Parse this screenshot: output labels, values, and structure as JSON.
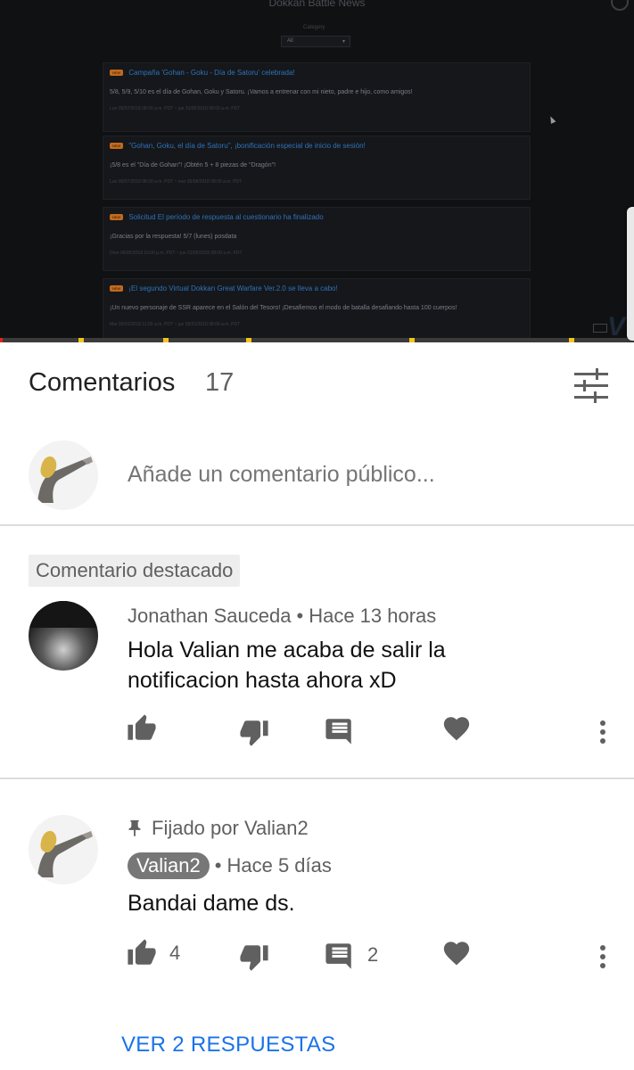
{
  "video": {
    "page_title": "Dokkan Battle News",
    "category_label": "Category",
    "category_value": "All",
    "news": [
      {
        "badge": "NEW",
        "title": "Campaña 'Gohan - Goku - Día de Satoru' celebrada!",
        "body": "5/8, 5/9, 5/10 es el día de Gohan, Goku y Satoru. ¡Vamos a entrenar con mi nieto, padre e hijo, como amigos!",
        "date": "Lun 05/07/2018 08:00 a.m. PDT ~ jue 31/05/2018 08:00 a.m. PDT"
      },
      {
        "badge": "NEW",
        "title": "\"Gohan, Goku, el día de Satoru\", ¡bonificación especial de inicio de sesión!",
        "body": "¡5/8 es el \"Día de Gohan\"! ¡Obtén 5 + 8 piezas de \"Dragón\"!",
        "date": "Lun 05/07/2018 08:00 a.m. PDT ~ mar 05/08/2018 08:00 a.m. PDT"
      },
      {
        "badge": "NEW",
        "title": "Solicitud El período de respuesta al cuestionario ha finalizado",
        "body": "¡Gracias por la respuesta! 5/7 (lunes) posdata",
        "date": "Dom 06/05/2018 10:00 p.m. PDT ~ jue 31/05/2018 08:00 a.m. PDT"
      },
      {
        "badge": "NEW",
        "title": "¡El segundo Virtual Dokkan Great Warfare Ver.2.0 se lleva a cabo!",
        "body": "¡Un nuevo personaje de SSR aparece en el Salón del Tesoro! ¡Desafiemos el modo de batalla desafiando hasta 100 cuerpos!",
        "date": "Mar 05/01/2018 11:00 a.m. PDT ~ jue 05/31/2018 08:00 a.m. PDT"
      }
    ],
    "progress": 0.004,
    "watermark": "V"
  },
  "comments_header": {
    "title": "Comentarios",
    "count": "17",
    "sort_icon": "sort-filter-icon"
  },
  "add_comment": {
    "placeholder": "Añade un comentario público..."
  },
  "comments": [
    {
      "featured_label": "Comentario destacado",
      "author": "Jonathan Sauceda",
      "separator": "•",
      "time": "Hace 13 horas",
      "text": "Hola Valian me acaba de salir la notificacion hasta ahora xD",
      "likes": "",
      "replies": ""
    },
    {
      "pinned_label": "Fijado por Valian2",
      "author": "Valian2",
      "separator": "•",
      "time": "Hace 5 días",
      "text": "Bandai dame ds.",
      "likes": "4",
      "replies": "2",
      "view_replies": "VER 2 RESPUESTAS"
    }
  ],
  "colors": {
    "accent_link": "#1a73e8",
    "progress_played": "#e62117",
    "ad_marker": "#f2c51b",
    "icon_gray": "#606060"
  }
}
